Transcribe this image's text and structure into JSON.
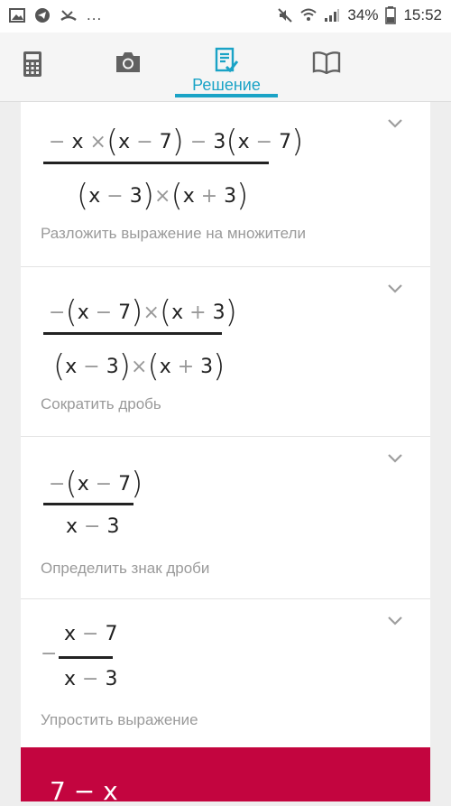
{
  "status_bar": {
    "battery": "34%",
    "time": "15:52",
    "dots": "..."
  },
  "toolbar": {
    "tabs": [
      {
        "name": "calculator",
        "icon": "calculator-icon"
      },
      {
        "name": "camera",
        "icon": "camera-icon"
      },
      {
        "name": "solution",
        "label": "Решение",
        "icon": "solution-icon"
      },
      {
        "name": "book",
        "icon": "book-icon"
      }
    ],
    "accent": "#1aa3c6"
  },
  "steps": [
    {
      "numerator": [
        "−",
        "x",
        "×",
        "(",
        "x",
        "−",
        "7",
        ")",
        "−",
        "3",
        "(",
        "x",
        "−",
        "7",
        ")"
      ],
      "denominator": [
        "(",
        "x",
        "−",
        "3",
        ")",
        "×",
        "(",
        "x",
        "+",
        "3",
        ")"
      ],
      "caption": "Разложить выражение на множители"
    },
    {
      "numerator": [
        "−",
        "(",
        "x",
        "−",
        "7",
        ")",
        "×",
        "(",
        "x",
        "+",
        "3",
        ")"
      ],
      "denominator": [
        "(",
        "x",
        "−",
        "3",
        ")",
        "×",
        "(",
        "x",
        "+",
        "3",
        ")"
      ],
      "caption": "Сократить дробь"
    },
    {
      "numerator": [
        "−",
        "(",
        "x",
        "−",
        "7",
        ")"
      ],
      "denominator": [
        "x",
        "−",
        "3"
      ],
      "caption": "Определить знак дроби"
    },
    {
      "sign": "−",
      "numerator": [
        "x",
        "−",
        "7"
      ],
      "denominator": [
        "x",
        "−",
        "3"
      ],
      "caption": "Упростить выражение"
    }
  ],
  "result": {
    "text": "7 − x",
    "color": "#c3053f"
  }
}
